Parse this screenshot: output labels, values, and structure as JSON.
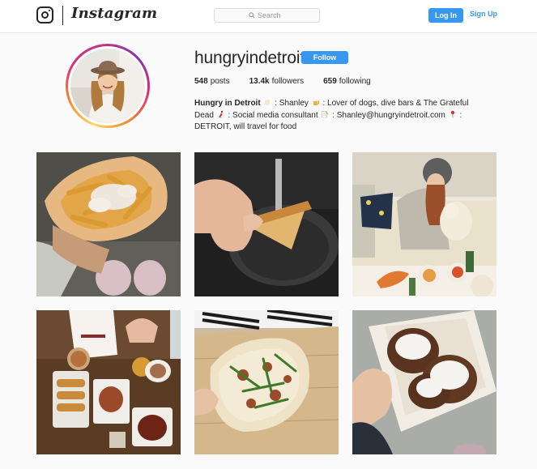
{
  "header": {
    "brand": "Instagram",
    "search_placeholder": "Search",
    "login_label": "Log In",
    "signup_label": "Sign Up",
    "icons": [
      "instagram-camera-icon",
      "search-icon"
    ]
  },
  "profile": {
    "username": "hungryindetroit",
    "follow_label": "Follow",
    "stats": {
      "posts_count": "548",
      "posts_label": "posts",
      "followers_count": "13.4k",
      "followers_label": "followers",
      "following_count": "659",
      "following_label": "following"
    },
    "bio": {
      "name": "Hungry in Detroit",
      "part1": ": Shanley",
      "part2": ": Lover of dogs, dive bars & The Grateful Dead",
      "part3": ": Social media consultant",
      "part4": ": Shanley@hungryindetroit.com",
      "part5": ": DETROIT, will travel for food",
      "emojis": [
        "hand-icon",
        "beer-icon",
        "dancer-icon",
        "memo-icon",
        "pin-icon"
      ]
    }
  },
  "posts": [
    {
      "subject": "poutine fries"
    },
    {
      "subject": "pie slice"
    },
    {
      "subject": "couch with dog"
    },
    {
      "subject": "bar table spread"
    },
    {
      "subject": "pizza flatbread"
    },
    {
      "subject": "sugar donuts"
    }
  ],
  "colors": {
    "accent": "#3897f0",
    "text": "#262626",
    "background": "#fafafa",
    "border": "#dbdbdb"
  }
}
